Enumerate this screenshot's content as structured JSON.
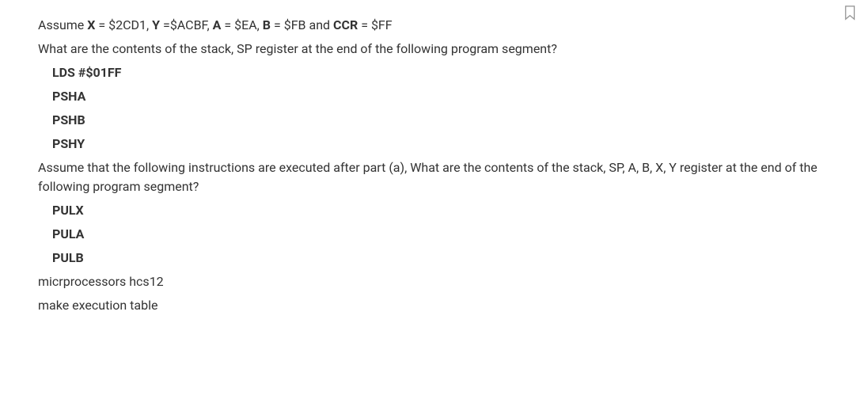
{
  "p1": {
    "t1": "Assume ",
    "b1": "X",
    "t2": " = $2CD1, ",
    "b2": "Y",
    "t3": " =$ACBF, ",
    "b3": "A",
    "t4": " = $EA, ",
    "b4": "B",
    "t5": " = $FB and ",
    "b5": "CCR",
    "t6": " = $FF"
  },
  "p2": "What are the contents of the stack, SP register at the end of the following program segment?",
  "code1": {
    "l1": "LDS #$01FF",
    "l2": "PSHA",
    "l3": "PSHB",
    "l4": "PSHY"
  },
  "p3": "Assume that the following instructions are executed after part (a), What are the contents of the stack, SP, A, B, X, Y register at the end of the following program segment?",
  "code2": {
    "l1": "PULX",
    "l2": "PULA",
    "l3": "PULB"
  },
  "p4": "micrprocessors hcs12",
  "p5": "make execution table"
}
